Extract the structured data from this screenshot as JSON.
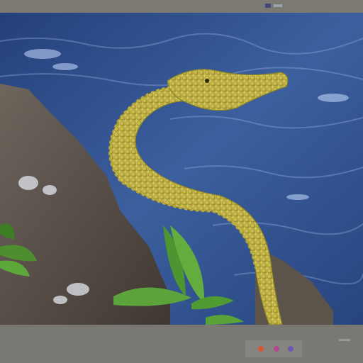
{
  "image": {
    "subject": "sea-serpent-on-rocks",
    "colors": {
      "water": "#2f4f8c",
      "water_light": "#6f93c6",
      "serpent": "#d7c552",
      "serpent_dark": "#8f8a2a",
      "rock": "#5a5048",
      "plant": "#5a9a3a",
      "ui_bar": "#7a7872"
    }
  },
  "toolbar": {
    "icons": [
      "tool-icon-1",
      "tool-icon-2",
      "tool-icon-3"
    ]
  }
}
